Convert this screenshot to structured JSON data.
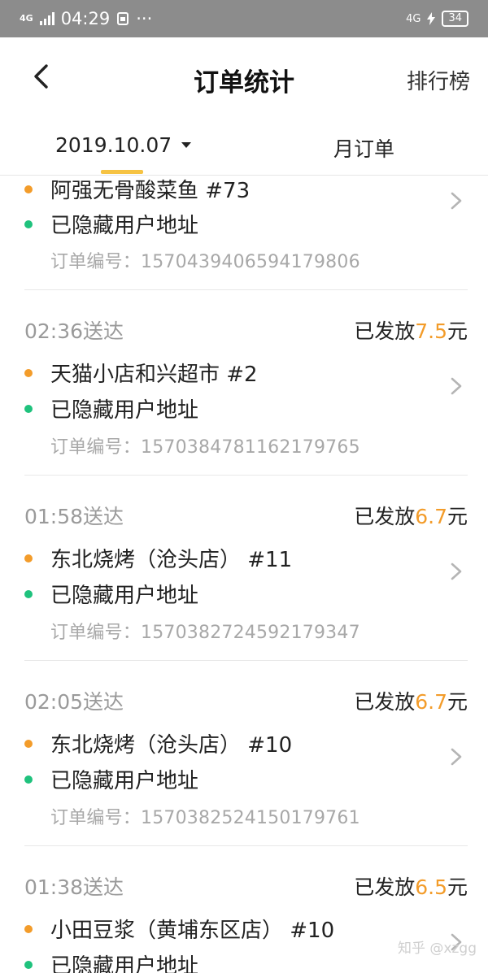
{
  "status": {
    "network": "4G",
    "time": "04:29",
    "icons": [
      "signal-icon",
      "sim-icon",
      "more-dots-icon"
    ],
    "right_network": "4G",
    "battery": "34"
  },
  "header": {
    "title": "订单统计",
    "right_action": "排行榜"
  },
  "filter": {
    "date": "2019.10.07",
    "month_tab": "月订单"
  },
  "orders": [
    {
      "time": "",
      "paid_prefix": "",
      "paid_amount": "",
      "paid_suffix": "",
      "shop": "阿强无骨酸菜鱼 #73",
      "address": "已隐藏用户地址",
      "order_no_label": "订单编号：",
      "order_no": "1570439406594179806"
    },
    {
      "time": "02:36送达",
      "paid_prefix": "已发放",
      "paid_amount": "7.5",
      "paid_suffix": "元",
      "shop": "天猫小店和兴超市 #2",
      "address": "已隐藏用户地址",
      "order_no_label": "订单编号：",
      "order_no": "1570384781162179765"
    },
    {
      "time": "01:58送达",
      "paid_prefix": "已发放",
      "paid_amount": "6.7",
      "paid_suffix": "元",
      "shop": "东北烧烤（沧头店） #11",
      "address": "已隐藏用户地址",
      "order_no_label": "订单编号：",
      "order_no": "1570382724592179347"
    },
    {
      "time": "02:05送达",
      "paid_prefix": "已发放",
      "paid_amount": "6.7",
      "paid_suffix": "元",
      "shop": "东北烧烤（沧头店） #10",
      "address": "已隐藏用户地址",
      "order_no_label": "订单编号：",
      "order_no": "1570382524150179761"
    },
    {
      "time": "01:38送达",
      "paid_prefix": "已发放",
      "paid_amount": "6.5",
      "paid_suffix": "元",
      "shop": "小田豆浆（黄埔东区店） #10",
      "address": "已隐藏用户地址",
      "order_no_label": "",
      "order_no": ""
    }
  ],
  "watermark": "知乎 @xzgg",
  "colors": {
    "accent": "#f39c2a",
    "pickup_dot": "#f39c2a",
    "delivery_dot": "#1fc27d",
    "tab_indicator": "#f6c343",
    "status_bar": "#8c8c8c"
  }
}
